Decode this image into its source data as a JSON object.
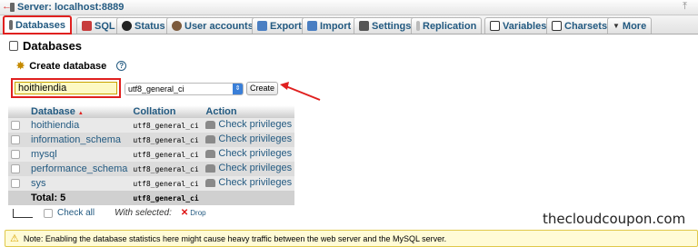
{
  "topbar": {
    "back_glyph": "←",
    "server_label": "Server: localhost:8889",
    "corner_glyph": "⤒"
  },
  "tabs": [
    {
      "label": "Databases",
      "icon": "database-icon",
      "active": true
    },
    {
      "label": "SQL",
      "icon": "sql-icon"
    },
    {
      "label": "Status",
      "icon": "status-icon"
    },
    {
      "label": "User accounts",
      "icon": "users-icon"
    },
    {
      "label": "Export",
      "icon": "export-icon"
    },
    {
      "label": "Import",
      "icon": "import-icon"
    },
    {
      "label": "Settings",
      "icon": "settings-icon"
    },
    {
      "label": "Replication",
      "icon": "replication-icon"
    },
    {
      "label": "Variables",
      "icon": "variables-icon"
    },
    {
      "label": "Charsets",
      "icon": "charsets-icon"
    },
    {
      "label": "More",
      "icon": "chevron-down-icon"
    }
  ],
  "page_title": "Databases",
  "create": {
    "title": "Create database",
    "help_glyph": "?",
    "db_name_value": "hoithiendia",
    "collation_selected": "utf8_general_ci",
    "create_button": "Create"
  },
  "table": {
    "headers": {
      "database": "Database",
      "collation": "Collation",
      "action": "Action"
    },
    "rows": [
      {
        "name": "hoithiendia",
        "collation": "utf8_general_ci",
        "action": "Check privileges"
      },
      {
        "name": "information_schema",
        "collation": "utf8_general_ci",
        "action": "Check privileges"
      },
      {
        "name": "mysql",
        "collation": "utf8_general_ci",
        "action": "Check privileges"
      },
      {
        "name": "performance_schema",
        "collation": "utf8_general_ci",
        "action": "Check privileges"
      },
      {
        "name": "sys",
        "collation": "utf8_general_ci",
        "action": "Check privileges"
      }
    ],
    "total_label": "Total: 5",
    "total_collation": "utf8_general_ci"
  },
  "bulk": {
    "check_all": "Check all",
    "with_selected": "With selected:",
    "drop": "Drop"
  },
  "watermark": "thecloudcoupon.com",
  "note": "Note: Enabling the database statistics here might cause heavy traffic between the web server and the MySQL server.",
  "colors": {
    "accent_red": "#e0201f",
    "link_blue": "#235a81",
    "note_bg": "#fffbd6"
  }
}
